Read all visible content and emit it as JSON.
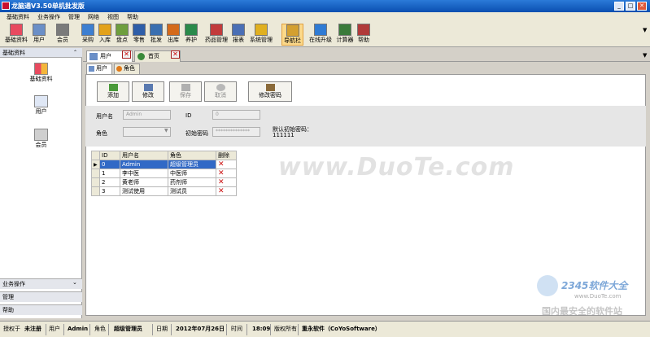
{
  "window": {
    "title": "龙脑通V3.50单机批发版",
    "minimize": "_",
    "maximize": "□",
    "close": "✕"
  },
  "menu": [
    "基础资料",
    "业务操作",
    "管理",
    "网络",
    "视图",
    "帮助"
  ],
  "toolbar": [
    {
      "label": "基础资料",
      "icon": "grid-icon",
      "color": "#e84a5f"
    },
    {
      "label": "用户",
      "icon": "user-card-icon",
      "color": "#6b8fc7"
    },
    {
      "label": "会员",
      "icon": "member-icon",
      "color": "#7a7a7a"
    },
    {
      "label": "采购",
      "icon": "purchase-icon",
      "color": "#3d7fd1"
    },
    {
      "label": "入库",
      "icon": "stock-in-icon",
      "color": "#e3a21a"
    },
    {
      "label": "盘点",
      "icon": "inventory-icon",
      "color": "#6e9e3c"
    },
    {
      "label": "零售",
      "icon": "retail-icon",
      "color": "#2e5ea8"
    },
    {
      "label": "批发",
      "icon": "wholesale-icon",
      "color": "#3a6fb0"
    },
    {
      "label": "出库",
      "icon": "stock-out-icon",
      "color": "#d46a1a"
    },
    {
      "label": "养护",
      "icon": "maintenance-icon",
      "color": "#2a8a4a"
    },
    {
      "label": "药品管理",
      "icon": "drug-icon",
      "color": "#c23b3b"
    },
    {
      "label": "报表",
      "icon": "report-icon",
      "color": "#4a6fb5"
    },
    {
      "label": "系统管理",
      "icon": "system-icon",
      "color": "#e0b020"
    },
    {
      "label": "导航栏",
      "icon": "navigation-icon",
      "color": "#d4a030"
    },
    {
      "label": "在线升级",
      "icon": "upgrade-globe-icon",
      "color": "#2f7bd4"
    },
    {
      "label": "计算器",
      "icon": "calculator-icon",
      "color": "#3a7a3a"
    },
    {
      "label": "帮助",
      "icon": "help-book-icon",
      "color": "#b03a3a"
    }
  ],
  "sidebar": {
    "header": "基础资料",
    "items": [
      {
        "label": "基础资料",
        "icon": "grid-icon"
      },
      {
        "label": "用户",
        "icon": "user-card-icon"
      },
      {
        "label": "会员",
        "icon": "member-icon"
      }
    ],
    "bottom": [
      "业务操作",
      "管理",
      "帮助"
    ]
  },
  "doc_tabs": [
    "用户",
    "首页"
  ],
  "sub_tabs": [
    "用户",
    "角色"
  ],
  "actions": {
    "add": "添加",
    "edit": "修改",
    "save": "保存",
    "cancel": "取消",
    "change_password": "修改密码"
  },
  "form": {
    "username_label": "用户名",
    "username_value": "Admin",
    "id_label": "ID",
    "id_value": "0",
    "role_label": "角色",
    "role_value": "",
    "initial_password_label": "初始密码",
    "initial_password_value": "**************",
    "default_password_note": "默认初始密码：",
    "default_password_value": "111111"
  },
  "grid": {
    "columns": [
      "ID",
      "用户名",
      "角色",
      "删除"
    ],
    "rows": [
      {
        "id": "0",
        "name": "Admin",
        "role": "超级管理员"
      },
      {
        "id": "1",
        "name": "李中医",
        "role": "中医师"
      },
      {
        "id": "2",
        "name": "黄老师",
        "role": "药剂师"
      },
      {
        "id": "3",
        "name": "测试使用",
        "role": "测试员"
      }
    ]
  },
  "statusbar": {
    "auth_label": "授权于",
    "auth_value": "未注册",
    "user_label": "用户",
    "user_value": "Admin",
    "role_label": "角色",
    "role_value": "超级管理员",
    "date_label": "日期",
    "date_value": "2012年07月26日",
    "time_label": "时间",
    "time_value": "18:09",
    "copyright_label": "版权所有",
    "copyright_value": "重永软件（CoYoSoftware）"
  },
  "watermark": {
    "main": "www.DuoTe.com",
    "brand": "2345软件大全",
    "site": "www.DuoTe.com",
    "slogan": "国内最安全的软件站"
  }
}
